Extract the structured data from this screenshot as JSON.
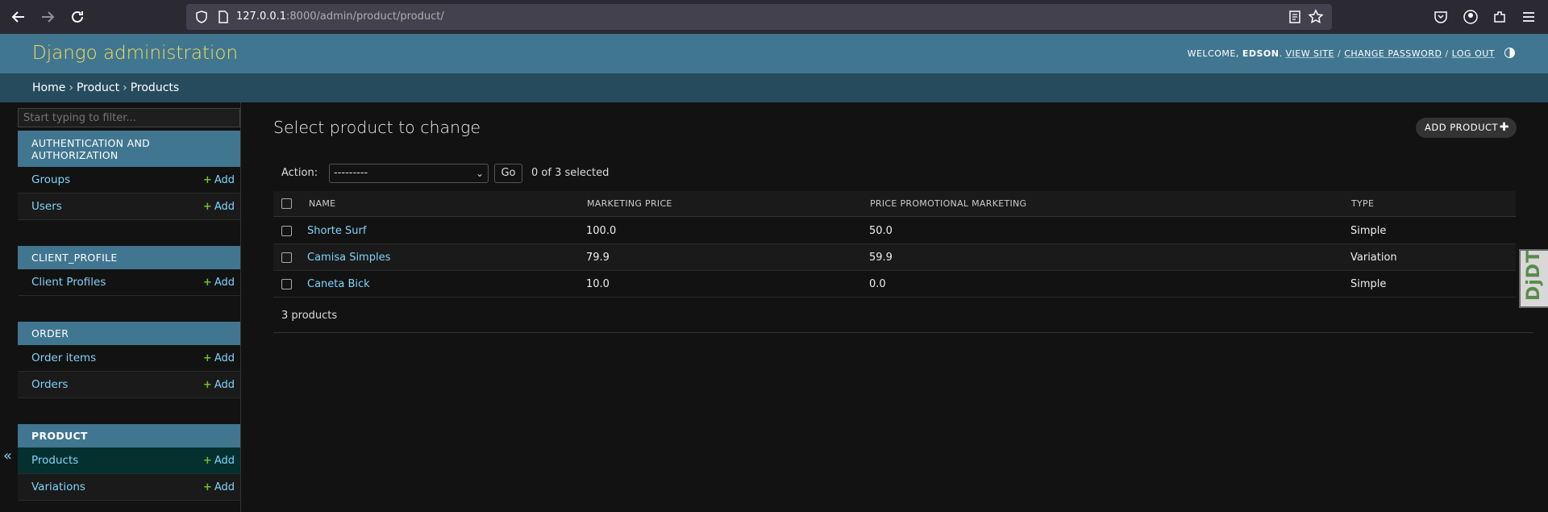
{
  "browser": {
    "url_host": "127.0.0.1",
    "url_rest": ":8000/admin/product/product/"
  },
  "header": {
    "branding": "Django administration",
    "welcome": "Welcome,",
    "username": "Edson",
    "view_site": "View site",
    "change_password": "Change password",
    "log_out": "Log out",
    "sep": "/"
  },
  "breadcrumbs": [
    "Home",
    "Product",
    "Products"
  ],
  "sidebar": {
    "filter_placeholder": "Start typing to filter...",
    "add_label": "Add",
    "collapse_glyph": "«",
    "modules": [
      {
        "title": "Authentication and Authorization",
        "models": [
          "Groups",
          "Users"
        ]
      },
      {
        "title": "Client_profile",
        "models": [
          "Client Profiles"
        ]
      },
      {
        "title": "Order",
        "models": [
          "Order items",
          "Orders"
        ]
      },
      {
        "title": "Product",
        "models": [
          "Products",
          "Variations"
        ],
        "current": true
      }
    ]
  },
  "main": {
    "title": "Select product to change",
    "add_button": "Add product",
    "action_label": "Action:",
    "action_selected": "---------",
    "go_label": "Go",
    "counter": "0 of 3 selected",
    "columns": [
      "Name",
      "Marketing price",
      "Price promotional marketing",
      "Type"
    ],
    "rows": [
      {
        "name": "Shorte Surf",
        "marketing_price": "100.0",
        "promo_price": "50.0",
        "type": "Simple"
      },
      {
        "name": "Camisa Simples",
        "marketing_price": "79.9",
        "promo_price": "59.9",
        "type": "Variation"
      },
      {
        "name": "Caneta Bick",
        "marketing_price": "10.0",
        "promo_price": "0.0",
        "type": "Simple"
      }
    ],
    "paginator": "3 products"
  },
  "debug_toolbar": {
    "label": "DjDT"
  },
  "colors": {
    "header_bg": "#417690",
    "branding": "#f5dd5d",
    "breadcrumbs_bg": "#264b5d",
    "link": "#81d4fa",
    "add_plus": "#70bf2b",
    "selected_row": "#04302f"
  }
}
